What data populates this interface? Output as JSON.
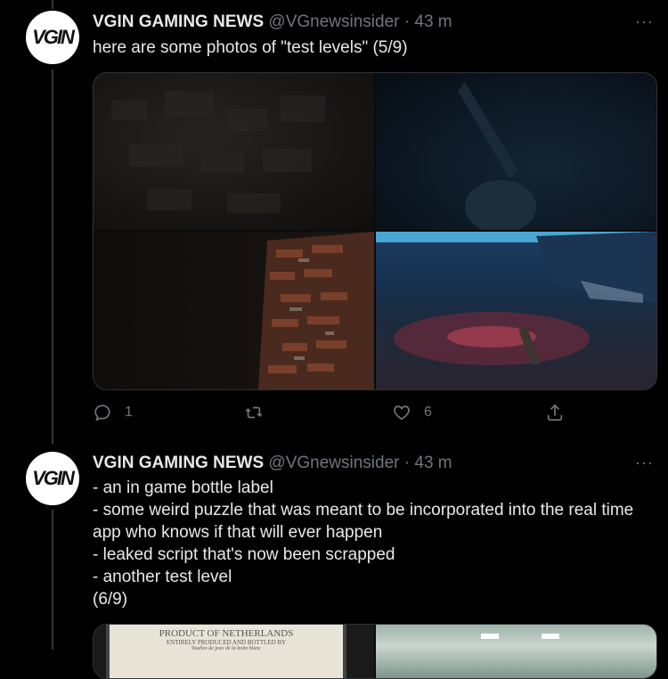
{
  "tweets": [
    {
      "avatar_text": "VGIN",
      "name": "VGIN GAMING NEWS",
      "handle": "@VGnewsinsider",
      "separator": "·",
      "time": "43 m",
      "more": "···",
      "text_lines": [
        "here are some photos of \"test levels\" (5/9)"
      ],
      "actions": {
        "reply_count": "1",
        "retweet_count": "",
        "like_count": "6"
      }
    },
    {
      "avatar_text": "VGIN",
      "name": "VGIN GAMING NEWS",
      "handle": "@VGnewsinsider",
      "separator": "·",
      "time": "43 m",
      "more": "···",
      "text_lines": [
        "- an in game bottle label",
        "- some weird puzzle that was meant to be incorporated into the real time",
        "app who knows if that will ever happen",
        "- leaked script that's now been scrapped",
        "- another test level",
        "(6/9)"
      ],
      "label_image": {
        "line1": "PRODUCT OF NETHERLANDS",
        "line2": "ENTIRELY PRODUCED AND BOTTLED BY",
        "line3": "Studios de jeux de la boite blanc"
      }
    }
  ],
  "colors": {
    "background": "#000000",
    "text": "#e7e9ea",
    "muted": "#71767b",
    "border": "#2f3336"
  }
}
